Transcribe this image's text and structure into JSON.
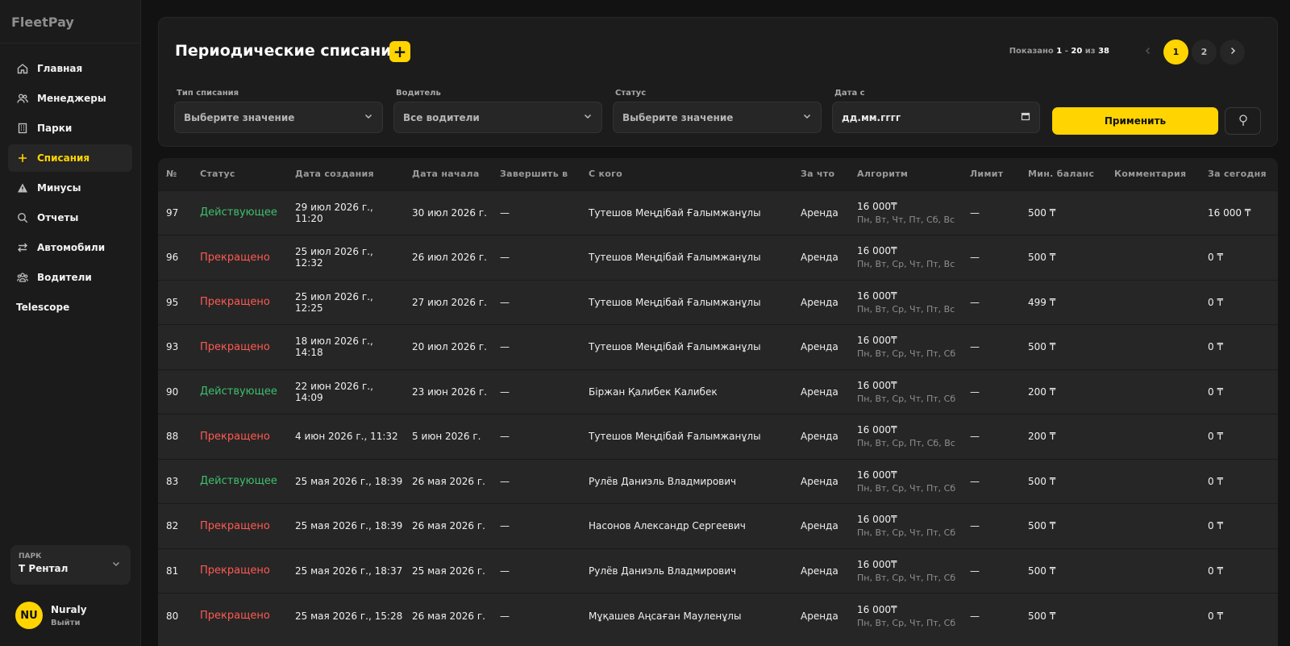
{
  "app": {
    "name": "FleetPay"
  },
  "sidebar": {
    "items": [
      {
        "label": "Главная",
        "icon": "home-icon",
        "active": false
      },
      {
        "label": "Менеджеры",
        "icon": "users-icon",
        "active": false
      },
      {
        "label": "Парки",
        "icon": "building-icon",
        "active": false
      },
      {
        "label": "Списания",
        "icon": "plus-icon",
        "active": true
      },
      {
        "label": "Минусы",
        "icon": "warning-icon",
        "active": false
      },
      {
        "label": "Отчеты",
        "icon": "search-icon",
        "active": false
      },
      {
        "label": "Автомобили",
        "icon": "swap-icon",
        "active": false
      },
      {
        "label": "Водители",
        "icon": "drivers-icon",
        "active": false
      },
      {
        "label": "Telescope",
        "icon": "",
        "active": false
      }
    ],
    "park": {
      "caption": "ПАРК",
      "value": "T Рентал"
    },
    "user": {
      "initials": "NU",
      "name": "Nuraly",
      "logout": "Выйти"
    }
  },
  "header": {
    "title": "Периодические списания",
    "add_label": "+",
    "shown_prefix": "Показано ",
    "shown_from": "1",
    "shown_sep": " - ",
    "shown_to": "20",
    "shown_of": " из ",
    "shown_total": "38",
    "pages": [
      "1",
      "2"
    ],
    "current_page": "1"
  },
  "filters": [
    {
      "label": "Тип списания",
      "value": "Выберите значение"
    },
    {
      "label": "Водитель",
      "value": "Все водители"
    },
    {
      "label": "Статус",
      "value": "Выберите значение"
    },
    {
      "label": "Дата с",
      "value": "дд.мм.гггг"
    }
  ],
  "apply_label": "Применить",
  "accent_color": "#ffd400",
  "status_colors": {
    "active": "#3fbf6e",
    "stopped": "#ff5a52"
  },
  "table": {
    "columns": [
      "№",
      "Статус",
      "Дата создания",
      "Дата начала",
      "Завершить в",
      "С кого",
      "За что",
      "Алгоритм",
      "Лимит",
      "Мин. баланс",
      "Комментария",
      "За сегодня"
    ],
    "rows": [
      {
        "no": "97",
        "status": "Действующее",
        "kind": "active",
        "created": "29 июл 2026 г., 11:20",
        "start": "30 июл 2026 г.",
        "end": "—",
        "from": "Тутешов Меңдібай Ғалымжанұлы",
        "for": "Аренда",
        "alg_amount": "16 000₸",
        "alg_days": "Пн, Вт, Чт, Пт, Сб, Вс",
        "limit": "—",
        "min_balance": "500 ₸",
        "comment": "",
        "today": "16 000 ₸"
      },
      {
        "no": "96",
        "status": "Прекращено",
        "kind": "stopped",
        "created": "25 июл 2026 г., 12:32",
        "start": "26 июл 2026 г.",
        "end": "—",
        "from": "Тутешов Меңдібай Ғалымжанұлы",
        "for": "Аренда",
        "alg_amount": "16 000₸",
        "alg_days": "Пн, Вт, Ср, Чт, Пт, Вс",
        "limit": "—",
        "min_balance": "500 ₸",
        "comment": "",
        "today": "0 ₸"
      },
      {
        "no": "95",
        "status": "Прекращено",
        "kind": "stopped",
        "created": "25 июл 2026 г., 12:25",
        "start": "27 июл 2026 г.",
        "end": "—",
        "from": "Тутешов Меңдібай Ғалымжанұлы",
        "for": "Аренда",
        "alg_amount": "16 000₸",
        "alg_days": "Пн, Вт, Ср, Чт, Пт, Вс",
        "limit": "—",
        "min_balance": "499 ₸",
        "comment": "",
        "today": "0 ₸"
      },
      {
        "no": "93",
        "status": "Прекращено",
        "kind": "stopped",
        "created": "18 июл 2026 г., 14:18",
        "start": "20 июл 2026 г.",
        "end": "—",
        "from": "Тутешов Меңдібай Ғалымжанұлы",
        "for": "Аренда",
        "alg_amount": "16 000₸",
        "alg_days": "Пн, Вт, Ср, Чт, Пт, Сб",
        "limit": "—",
        "min_balance": "500 ₸",
        "comment": "",
        "today": "0 ₸"
      },
      {
        "no": "90",
        "status": "Действующее",
        "kind": "active",
        "created": "22 июн 2026 г., 14:09",
        "start": "23 июн 2026 г.",
        "end": "—",
        "from": "Біржан Қалибек Калибек",
        "for": "Аренда",
        "alg_amount": "16 000₸",
        "alg_days": "Пн, Вт, Ср, Чт, Пт, Сб",
        "limit": "—",
        "min_balance": "200 ₸",
        "comment": "",
        "today": "0 ₸"
      },
      {
        "no": "88",
        "status": "Прекращено",
        "kind": "stopped",
        "created": "4 июн 2026 г., 11:32",
        "start": "5 июн 2026 г.",
        "end": "—",
        "from": "Тутешов Меңдібай Ғалымжанұлы",
        "for": "Аренда",
        "alg_amount": "16 000₸",
        "alg_days": "Пн, Вт, Ср, Пт, Сб, Вс",
        "limit": "—",
        "min_balance": "200 ₸",
        "comment": "",
        "today": "0 ₸"
      },
      {
        "no": "83",
        "status": "Действующее",
        "kind": "active",
        "created": "25 мая 2026 г., 18:39",
        "start": "26 мая 2026 г.",
        "end": "—",
        "from": "Рулёв Даниэль Владмирович",
        "for": "Аренда",
        "alg_amount": "16 000₸",
        "alg_days": "Пн, Вт, Ср, Чт, Пт, Сб",
        "limit": "—",
        "min_balance": "500 ₸",
        "comment": "",
        "today": "0 ₸"
      },
      {
        "no": "82",
        "status": "Прекращено",
        "kind": "stopped",
        "created": "25 мая 2026 г., 18:39",
        "start": "26 мая 2026 г.",
        "end": "—",
        "from": "Насонов Александр Сергеевич",
        "for": "Аренда",
        "alg_amount": "16 000₸",
        "alg_days": "Пн, Вт, Ср, Чт, Пт, Сб",
        "limit": "—",
        "min_balance": "500 ₸",
        "comment": "",
        "today": "0 ₸"
      },
      {
        "no": "81",
        "status": "Прекращено",
        "kind": "stopped",
        "created": "25 мая 2026 г., 18:37",
        "start": "25 мая 2026 г.",
        "end": "—",
        "from": "Рулёв Даниэль Владмирович",
        "for": "Аренда",
        "alg_amount": "16 000₸",
        "alg_days": "Пн, Вт, Ср, Чт, Пт, Сб",
        "limit": "—",
        "min_balance": "500 ₸",
        "comment": "",
        "today": "0 ₸"
      },
      {
        "no": "80",
        "status": "Прекращено",
        "kind": "stopped",
        "created": "25 мая 2026 г., 15:28",
        "start": "26 мая 2026 г.",
        "end": "—",
        "from": "Мұқашев Аңсаған Мауленұлы",
        "for": "Аренда",
        "alg_amount": "16 000₸",
        "alg_days": "Пн, Вт, Ср, Чт, Пт, Сб",
        "limit": "—",
        "min_balance": "500 ₸",
        "comment": "",
        "today": "0 ₸"
      }
    ]
  }
}
